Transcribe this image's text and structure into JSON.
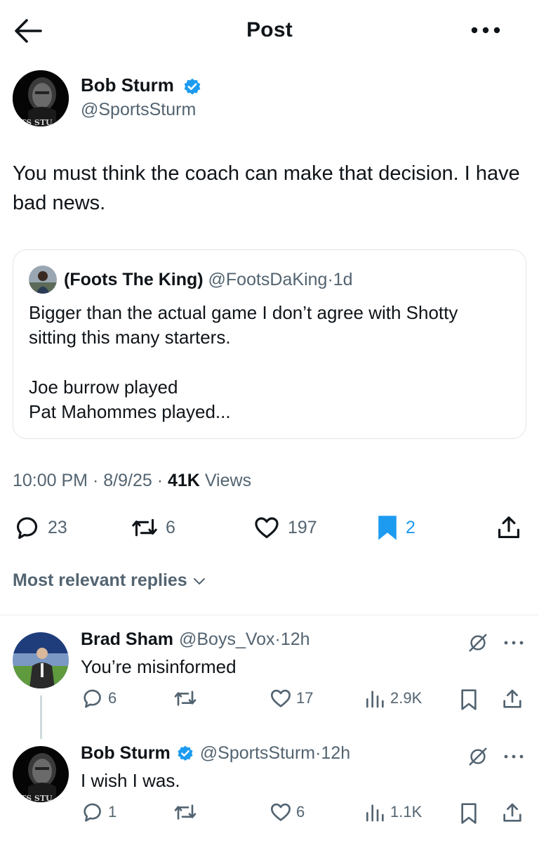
{
  "header": {
    "title": "Post",
    "back_icon": "arrow-left-icon",
    "more_icon": "more-horizontal-icon"
  },
  "post": {
    "author": {
      "name": "Bob Sturm",
      "handle": "@SportsSturm",
      "verified": true,
      "avatar_text": "RTS STU"
    },
    "text": "You must think the coach can make that decision. I have bad news.",
    "quote": {
      "name": "(Foots The King)",
      "handle": "@FootsDaKing",
      "separator": "·",
      "time": "1d",
      "line1": "Bigger than the actual game I don’t agree with Shotty",
      "line2": "sitting this many starters.",
      "line3": "Joe burrow played",
      "line4": "Pat Mahommes played..."
    },
    "timestamp": {
      "time": "10:00 PM",
      "sep": "·",
      "date": "8/9/25",
      "views_count": "41K",
      "views_label": "Views"
    },
    "stats": {
      "replies": "23",
      "reposts": "6",
      "likes": "197",
      "bookmarks": "2"
    }
  },
  "replies_filter": {
    "label": "Most relevant replies"
  },
  "replies": [
    {
      "name": "Brad Sham",
      "handle": "@Boys_Vox",
      "separator": "·",
      "time": "12h",
      "text": "You’re misinformed",
      "stats": {
        "replies": "6",
        "reposts": "",
        "likes": "17",
        "views": "2.9K"
      }
    },
    {
      "name": "Bob Sturm",
      "handle": "@SportsSturm",
      "separator": "·",
      "time": "12h",
      "verified": true,
      "avatar_text": "RTS STU",
      "text": "I wish I was.",
      "stats": {
        "replies": "1",
        "reposts": "",
        "likes": "6",
        "views": "1.1K"
      }
    }
  ],
  "colors": {
    "text": "#0f1419",
    "secondary": "#536471",
    "accent": "#1d9bf0",
    "border": "#e1e6ea"
  }
}
